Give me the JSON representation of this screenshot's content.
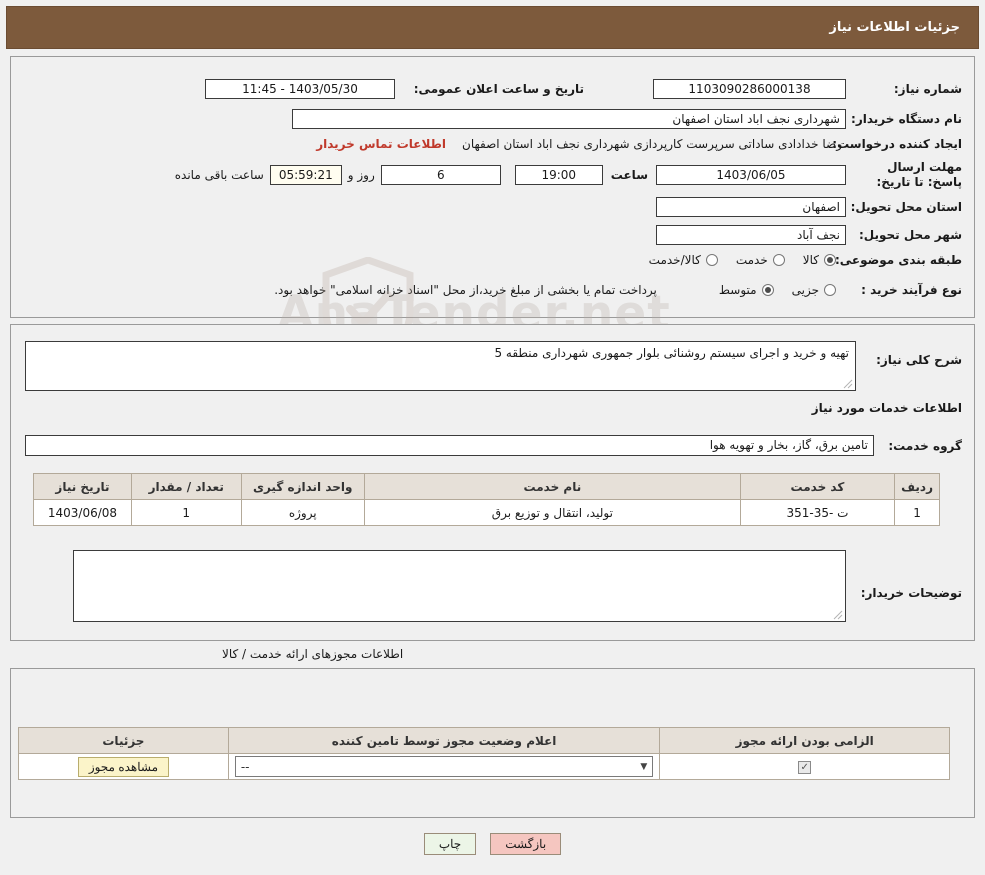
{
  "header": {
    "title": "جزئیات اطلاعات نیاز"
  },
  "form": {
    "need_number_label": "شماره نیاز:",
    "need_number_value": "1103090286000138",
    "announce_datetime_label": "تاریخ و ساعت اعلان عمومی:",
    "announce_datetime_value": "1403/05/30 - 11:45",
    "buyer_org_label": "نام دستگاه خریدار:",
    "buyer_org_value": "شهرداری نجف اباد استان اصفهان",
    "creator_label": "ایجاد کننده درخواست:",
    "creator_value": "رضا خدادادی ساداتی سرپرست  کارپردازی شهرداری نجف اباد استان اصفهان",
    "contact_link": "اطلاعات تماس خریدار",
    "deadline_label": "مهلت ارسال پاسخ: تا تاریخ:",
    "deadline_date": "1403/06/05",
    "hour_label": "ساعت",
    "deadline_time": "19:00",
    "days_value": "6",
    "days_label": "روز و",
    "countdown_value": "05:59:21",
    "remaining_label": "ساعت باقی مانده",
    "province_label": "استان محل تحویل:",
    "province_value": "اصفهان",
    "city_label": "شهر محل تحویل:",
    "city_value": "نجف آباد",
    "category_label": "طبقه بندی موضوعی:",
    "category_options": [
      {
        "label": "کالا",
        "selected": true
      },
      {
        "label": "خدمت",
        "selected": false
      },
      {
        "label": "کالا/خدمت",
        "selected": false
      }
    ],
    "process_label": "نوع فرآیند خرید :",
    "process_options": [
      {
        "label": "جزیی",
        "selected": false
      },
      {
        "label": "متوسط",
        "selected": true
      }
    ],
    "process_note": "پرداخت تمام یا بخشی از مبلغ خرید،از محل \"اسناد خزانه اسلامی\" خواهد بود."
  },
  "description": {
    "general_label": "شرح کلی نیاز:",
    "general_value": "تهیه و خرید و اجرای سیستم روشنائی بلوار جمهوری شهرداری منطقه 5",
    "services_title": "اطلاعات خدمات مورد نیاز",
    "service_group_label": "گروه خدمت:",
    "service_group_value": "تامین برق، گاز، بخار و تهویه هوا",
    "table": {
      "headers": [
        "ردیف",
        "کد خدمت",
        "نام خدمت",
        "واحد اندازه گیری",
        "تعداد / مقدار",
        "تاریخ نیاز"
      ],
      "rows": [
        [
          "1",
          "ت -35-351",
          "تولید، انتقال و توزیع برق",
          "پروژه",
          "1",
          "1403/06/08"
        ]
      ]
    },
    "buyer_notes_label": "توضیحات خریدار:",
    "buyer_notes_value": ""
  },
  "permits": {
    "section_label": "اطلاعات مجوزهای ارائه خدمت / کالا",
    "table": {
      "headers": [
        "الزامی بودن ارائه مجوز",
        "اعلام وضعیت مجوز توسط تامین کننده",
        "جزئیات"
      ],
      "row": {
        "required_checked": true,
        "status_select": "--",
        "details_button": "مشاهده مجوز"
      }
    }
  },
  "footer": {
    "print_button": "چاپ",
    "back_button": "بازگشت"
  },
  "watermark": {
    "text": "AnaTender.net"
  },
  "colors": {
    "header_bg": "#7d5a3c",
    "accent_link": "#c0392b",
    "table_header_bg": "#e6e0d8"
  }
}
